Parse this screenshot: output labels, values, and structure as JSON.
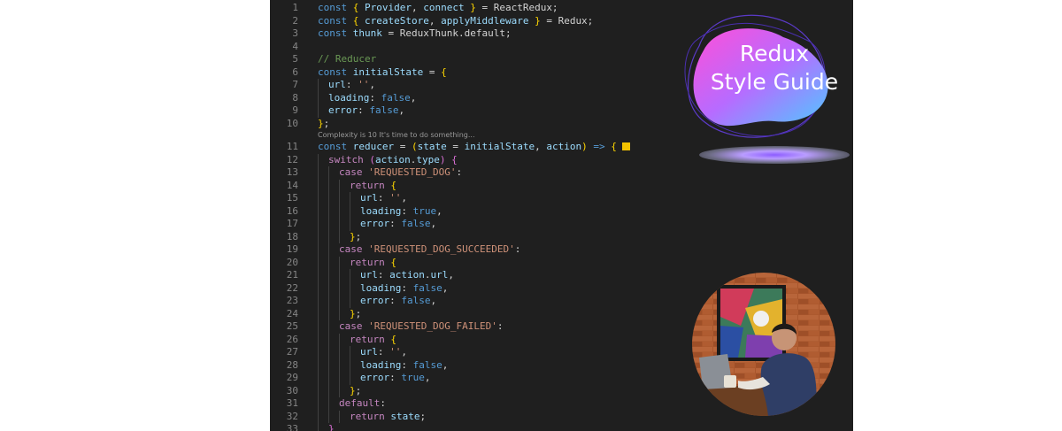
{
  "editor": {
    "code_lens": "Complexity is 10 It's time to do something...",
    "lines": [
      {
        "n": "1",
        "i": 0,
        "t": [
          [
            "kw",
            "const "
          ],
          [
            "br",
            "{ "
          ],
          [
            "var",
            "Provider"
          ],
          [
            "txt",
            ", "
          ],
          [
            "var",
            "connect "
          ],
          [
            "br",
            "}"
          ],
          [
            "txt",
            " = ReactRedux;"
          ]
        ]
      },
      {
        "n": "2",
        "i": 0,
        "t": [
          [
            "kw",
            "const "
          ],
          [
            "br",
            "{ "
          ],
          [
            "var",
            "createStore"
          ],
          [
            "txt",
            ", "
          ],
          [
            "var",
            "applyMiddleware "
          ],
          [
            "br",
            "}"
          ],
          [
            "txt",
            " = Redux;"
          ]
        ]
      },
      {
        "n": "3",
        "i": 0,
        "t": [
          [
            "kw",
            "const "
          ],
          [
            "var",
            "thunk"
          ],
          [
            "txt",
            " = ReduxThunk.default;"
          ]
        ]
      },
      {
        "n": "4",
        "i": 0,
        "t": []
      },
      {
        "n": "5",
        "i": 0,
        "t": [
          [
            "cmt",
            "// Reducer"
          ]
        ]
      },
      {
        "n": "6",
        "i": 0,
        "t": [
          [
            "kw",
            "const "
          ],
          [
            "var",
            "initialState"
          ],
          [
            "txt",
            " = "
          ],
          [
            "br",
            "{"
          ]
        ]
      },
      {
        "n": "7",
        "i": 1,
        "t": [
          [
            "var",
            "url"
          ],
          [
            "txt",
            ": "
          ],
          [
            "str",
            "''"
          ],
          [
            "txt",
            ","
          ]
        ]
      },
      {
        "n": "8",
        "i": 1,
        "t": [
          [
            "var",
            "loading"
          ],
          [
            "txt",
            ": "
          ],
          [
            "kw",
            "false"
          ],
          [
            "txt",
            ","
          ]
        ]
      },
      {
        "n": "9",
        "i": 1,
        "t": [
          [
            "var",
            "error"
          ],
          [
            "txt",
            ": "
          ],
          [
            "kw",
            "false"
          ],
          [
            "txt",
            ","
          ]
        ]
      },
      {
        "n": "10",
        "i": 0,
        "t": [
          [
            "br",
            "}"
          ],
          [
            "txt",
            ";"
          ]
        ]
      },
      {
        "n": "11",
        "i": 0,
        "lens": true,
        "square": true,
        "t": [
          [
            "kw",
            "const "
          ],
          [
            "var",
            "reducer"
          ],
          [
            "txt",
            " = "
          ],
          [
            "br",
            "("
          ],
          [
            "var",
            "state"
          ],
          [
            "txt",
            " = "
          ],
          [
            "var",
            "initialState"
          ],
          [
            "txt",
            ", "
          ],
          [
            "var",
            "action"
          ],
          [
            "br",
            ")"
          ],
          [
            "kw",
            " => "
          ],
          [
            "br",
            "{"
          ]
        ]
      },
      {
        "n": "12",
        "i": 1,
        "t": [
          [
            "ctl",
            "switch "
          ],
          [
            "br2",
            "("
          ],
          [
            "var",
            "action"
          ],
          [
            "txt",
            "."
          ],
          [
            "var",
            "type"
          ],
          [
            "br2",
            ")"
          ],
          [
            "txt",
            " "
          ],
          [
            "br2",
            "{"
          ]
        ]
      },
      {
        "n": "13",
        "i": 2,
        "t": [
          [
            "ctl",
            "case "
          ],
          [
            "str",
            "'REQUESTED_DOG'"
          ],
          [
            "txt",
            ":"
          ]
        ]
      },
      {
        "n": "14",
        "i": 3,
        "t": [
          [
            "ctl",
            "return "
          ],
          [
            "br",
            "{"
          ]
        ]
      },
      {
        "n": "15",
        "i": 4,
        "t": [
          [
            "var",
            "url"
          ],
          [
            "txt",
            ": "
          ],
          [
            "str",
            "''"
          ],
          [
            "txt",
            ","
          ]
        ]
      },
      {
        "n": "16",
        "i": 4,
        "t": [
          [
            "var",
            "loading"
          ],
          [
            "txt",
            ": "
          ],
          [
            "kw",
            "true"
          ],
          [
            "txt",
            ","
          ]
        ]
      },
      {
        "n": "17",
        "i": 4,
        "t": [
          [
            "var",
            "error"
          ],
          [
            "txt",
            ": "
          ],
          [
            "kw",
            "false"
          ],
          [
            "txt",
            ","
          ]
        ]
      },
      {
        "n": "18",
        "i": 3,
        "t": [
          [
            "br",
            "}"
          ],
          [
            "txt",
            ";"
          ]
        ]
      },
      {
        "n": "19",
        "i": 2,
        "t": [
          [
            "ctl",
            "case "
          ],
          [
            "str",
            "'REQUESTED_DOG_SUCCEEDED'"
          ],
          [
            "txt",
            ":"
          ]
        ]
      },
      {
        "n": "20",
        "i": 3,
        "t": [
          [
            "ctl",
            "return "
          ],
          [
            "br",
            "{"
          ]
        ]
      },
      {
        "n": "21",
        "i": 4,
        "t": [
          [
            "var",
            "url"
          ],
          [
            "txt",
            ": "
          ],
          [
            "var",
            "action"
          ],
          [
            "txt",
            "."
          ],
          [
            "var",
            "url"
          ],
          [
            "txt",
            ","
          ]
        ]
      },
      {
        "n": "22",
        "i": 4,
        "t": [
          [
            "var",
            "loading"
          ],
          [
            "txt",
            ": "
          ],
          [
            "kw",
            "false"
          ],
          [
            "txt",
            ","
          ]
        ]
      },
      {
        "n": "23",
        "i": 4,
        "t": [
          [
            "var",
            "error"
          ],
          [
            "txt",
            ": "
          ],
          [
            "kw",
            "false"
          ],
          [
            "txt",
            ","
          ]
        ]
      },
      {
        "n": "24",
        "i": 3,
        "t": [
          [
            "br",
            "}"
          ],
          [
            "txt",
            ";"
          ]
        ]
      },
      {
        "n": "25",
        "i": 2,
        "t": [
          [
            "ctl",
            "case "
          ],
          [
            "str",
            "'REQUESTED_DOG_FAILED'"
          ],
          [
            "txt",
            ":"
          ]
        ]
      },
      {
        "n": "26",
        "i": 3,
        "t": [
          [
            "ctl",
            "return "
          ],
          [
            "br",
            "{"
          ]
        ]
      },
      {
        "n": "27",
        "i": 4,
        "t": [
          [
            "var",
            "url"
          ],
          [
            "txt",
            ": "
          ],
          [
            "str",
            "''"
          ],
          [
            "txt",
            ","
          ]
        ]
      },
      {
        "n": "28",
        "i": 4,
        "t": [
          [
            "var",
            "loading"
          ],
          [
            "txt",
            ": "
          ],
          [
            "kw",
            "false"
          ],
          [
            "txt",
            ","
          ]
        ]
      },
      {
        "n": "29",
        "i": 4,
        "t": [
          [
            "var",
            "error"
          ],
          [
            "txt",
            ": "
          ],
          [
            "kw",
            "true"
          ],
          [
            "txt",
            ","
          ]
        ]
      },
      {
        "n": "30",
        "i": 3,
        "t": [
          [
            "br",
            "}"
          ],
          [
            "txt",
            ";"
          ]
        ]
      },
      {
        "n": "31",
        "i": 2,
        "t": [
          [
            "ctl",
            "default"
          ],
          [
            "txt",
            ":"
          ]
        ]
      },
      {
        "n": "32",
        "i": 3,
        "t": [
          [
            "ctl",
            "return "
          ],
          [
            "var",
            "state"
          ],
          [
            "txt",
            ";"
          ]
        ]
      },
      {
        "n": "33",
        "i": 1,
        "t": [
          [
            "br2",
            "}"
          ]
        ]
      }
    ]
  },
  "badge": {
    "line1": "Redux",
    "line2": "Style Guide",
    "colors": {
      "gradient_start": "#ff4fd8",
      "gradient_end": "#4fc8ff",
      "outline": "#6a3df0"
    }
  },
  "avatar": {
    "alt_icon": "author-photo"
  }
}
